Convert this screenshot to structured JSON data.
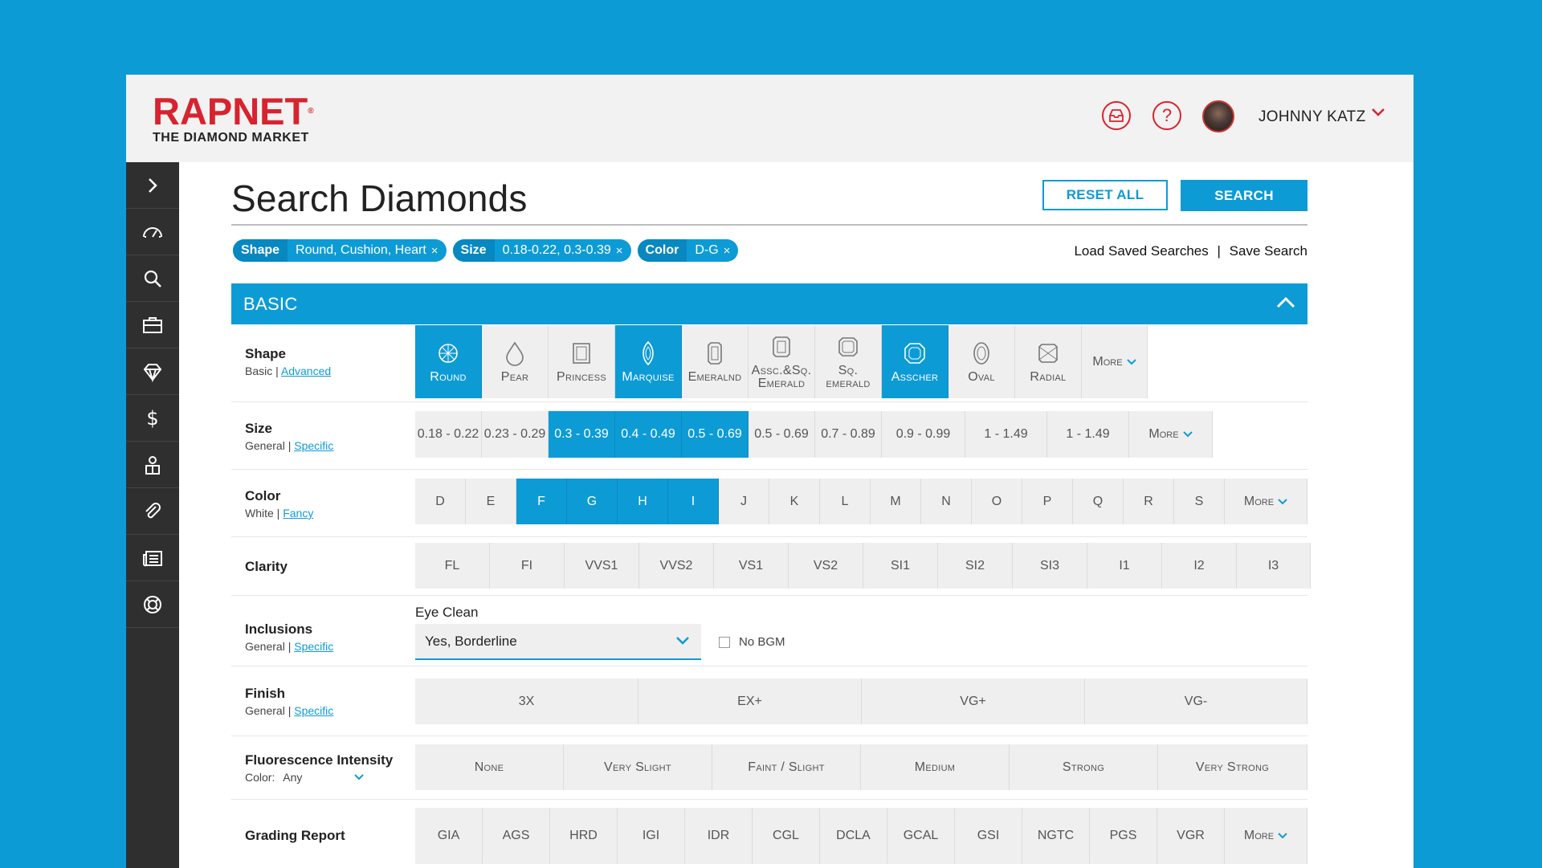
{
  "header": {
    "logo_main": "RAPNET",
    "logo_reg": "®",
    "logo_sub": "THE DIAMOND MARKET",
    "user_name": "JOHNNY KATZ"
  },
  "sidebar": {
    "items": [
      "expand",
      "dashboard",
      "search",
      "briefcase",
      "diamond",
      "pricing",
      "profile",
      "attachments",
      "news",
      "support"
    ]
  },
  "page": {
    "title": "Search Diamonds",
    "reset_label": "RESET ALL",
    "search_label": "SEARCH",
    "load_saved": "Load Saved Searches",
    "separator": "|",
    "save_search": "Save Search"
  },
  "chips": [
    {
      "key": "Shape",
      "value": "Round, Cushion, Heart",
      "x": "×"
    },
    {
      "key": "Size",
      "value": "0.18-0.22, 0.3-0.39",
      "x": "×"
    },
    {
      "key": "Color",
      "value": "D-G",
      "x": "×"
    }
  ],
  "section": {
    "title": "BASIC"
  },
  "shape": {
    "label": "Shape",
    "sub_a": "Basic",
    "sub_sep": " | ",
    "sub_b": "Advanced",
    "options": [
      {
        "label": "Round",
        "selected": true
      },
      {
        "label": "Pear",
        "selected": false
      },
      {
        "label": "Princess",
        "selected": false
      },
      {
        "label": "Marquise",
        "selected": true
      },
      {
        "label": "Emeralnd",
        "selected": false
      },
      {
        "label": "Assc.&Sq.",
        "label2": "Emerald",
        "selected": false
      },
      {
        "label": "Sq. emerald",
        "selected": false
      },
      {
        "label": "Asscher",
        "selected": true
      },
      {
        "label": "Oval",
        "selected": false
      },
      {
        "label": "Radial",
        "selected": false
      }
    ],
    "more": "More"
  },
  "size": {
    "label": "Size",
    "sub_a": "General",
    "sub_sep": " | ",
    "sub_b": "Specific",
    "options": [
      {
        "label": "0.18 - 0.22",
        "selected": false
      },
      {
        "label": "0.23 - 0.29",
        "selected": false
      },
      {
        "label": "0.3 - 0.39",
        "selected": true
      },
      {
        "label": "0.4 - 0.49",
        "selected": true
      },
      {
        "label": "0.5 - 0.69",
        "selected": true
      },
      {
        "label": "0.5 - 0.69",
        "selected": false
      },
      {
        "label": "0.7 - 0.89",
        "selected": false
      },
      {
        "label": "0.9 - 0.99",
        "selected": false
      },
      {
        "label": "1 - 1.49",
        "selected": false
      },
      {
        "label": "1 - 1.49",
        "selected": false
      }
    ],
    "more": "More"
  },
  "color": {
    "label": "Color",
    "sub_a": "White",
    "sub_sep": " | ",
    "sub_b": "Fancy",
    "options": [
      {
        "label": "D",
        "selected": false
      },
      {
        "label": "E",
        "selected": false
      },
      {
        "label": "F",
        "selected": true
      },
      {
        "label": "G",
        "selected": true
      },
      {
        "label": "H",
        "selected": true
      },
      {
        "label": "I",
        "selected": true
      },
      {
        "label": "J",
        "selected": false
      },
      {
        "label": "K",
        "selected": false
      },
      {
        "label": "L",
        "selected": false
      },
      {
        "label": "M",
        "selected": false
      },
      {
        "label": "N",
        "selected": false
      },
      {
        "label": "O",
        "selected": false
      },
      {
        "label": "P",
        "selected": false
      },
      {
        "label": "Q",
        "selected": false
      },
      {
        "label": "R",
        "selected": false
      },
      {
        "label": "S",
        "selected": false
      }
    ],
    "more": "More"
  },
  "clarity": {
    "label": "Clarity",
    "options": [
      "FL",
      "FI",
      "VVS1",
      "VVS2",
      "VS1",
      "VS2",
      "SI1",
      "SI2",
      "SI3",
      "I1",
      "I2",
      "I3"
    ]
  },
  "inclusions": {
    "label": "Inclusions",
    "sub_a": "General",
    "sub_sep": " | ",
    "sub_b": "Specific",
    "eye_clean_label": "Eye Clean",
    "eye_clean_value": "Yes, Borderline",
    "no_bgm": "No BGM"
  },
  "finish": {
    "label": "Finish",
    "sub_a": "General",
    "sub_sep": " | ",
    "sub_b": "Specific",
    "options": [
      "3X",
      "EX+",
      "VG+",
      "VG-"
    ]
  },
  "fluorescence": {
    "label": "Fluorescence Intensity",
    "color_label": "Color:",
    "color_value": "Any",
    "options": [
      "None",
      "Very Slight",
      "Faint / Slight",
      "Medium",
      "Strong",
      "Very Strong"
    ]
  },
  "grading": {
    "label": "Grading Report",
    "options": [
      "GIA",
      "AGS",
      "HRD",
      "IGI",
      "IDR",
      "CGL",
      "DCLA",
      "GCAL",
      "GSI",
      "NGTC",
      "PGS",
      "VGR"
    ],
    "more": "More"
  },
  "colors": {
    "accent": "#0d9bd6",
    "brand": "#d8232f",
    "sidebar": "#2f2f2f"
  }
}
